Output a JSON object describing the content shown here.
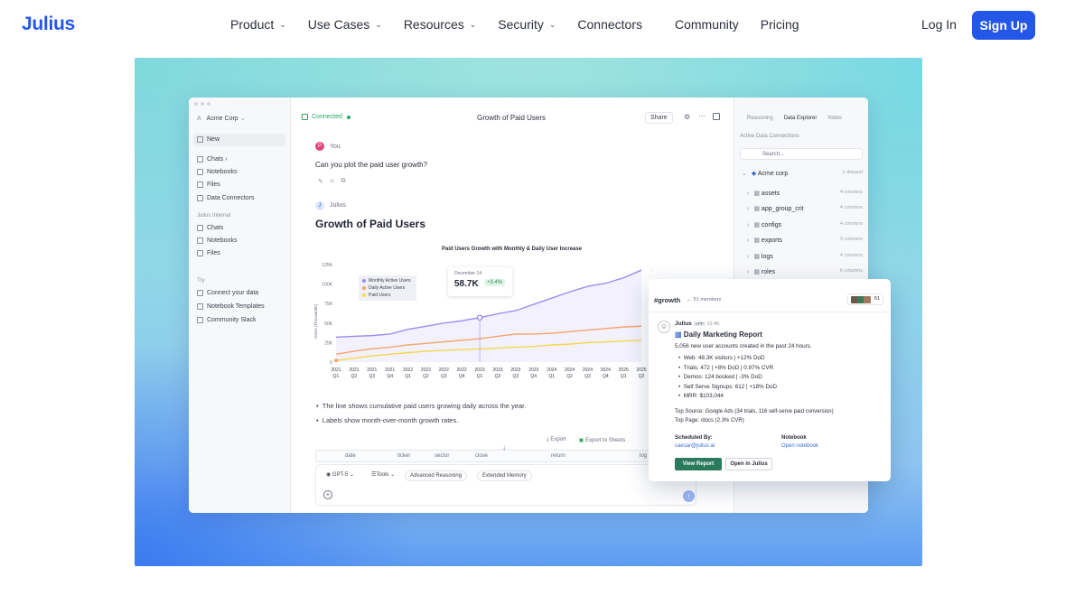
{
  "nav": {
    "logo": "Julius",
    "items": [
      {
        "label": "Product",
        "dropdown": true
      },
      {
        "label": "Use Cases",
        "dropdown": true
      },
      {
        "label": "Resources",
        "dropdown": true
      },
      {
        "label": "Security",
        "dropdown": true
      },
      {
        "label": "Connectors",
        "dropdown": false
      },
      {
        "label": "Community",
        "dropdown": false
      },
      {
        "label": "Pricing",
        "dropdown": false
      }
    ],
    "login": "Log In",
    "signup": "Sign Up"
  },
  "colors": {
    "brand": "#2457e8",
    "connected": "#27a660",
    "view_report": "#2c7a5d"
  },
  "app": {
    "sidebar": {
      "workspace": "Acme Corp",
      "new": "New",
      "items": [
        "Chats",
        "Notebooks",
        "Files",
        "Data Connectors"
      ],
      "section_internal": "Julius Internal",
      "internal_items": [
        "Chats",
        "Notebooks",
        "Files"
      ],
      "section_try": "Try",
      "try_items": [
        "Connect your data",
        "Notebook Templates",
        "Community Slack"
      ]
    },
    "topbar": {
      "connected": "Connected",
      "title": "Growth of Paid Users",
      "share": "Share"
    },
    "chat": {
      "user_initial": "P",
      "user_label": "You",
      "question": "Can you plot the paid user growth?",
      "assistant_initial": "J",
      "assistant_label": "Julius",
      "heading": "Growth of Paid Users",
      "bullets": [
        "The line shows cumulative paid users growing daily across the year.",
        "Labels show month-over-month growth rates."
      ],
      "export": "Export",
      "export_sheets": "Export to Sheets",
      "table_columns": [
        "date",
        "ticker",
        "sector",
        "close",
        "return",
        "log"
      ]
    },
    "composer": {
      "model": "GPT-5",
      "tools": "Tools",
      "chip1": "Advanced Reasoning",
      "chip2": "Extended Memory"
    },
    "right_panel": {
      "tabs": [
        "Reasoning",
        "Data Explorer",
        "Notes"
      ],
      "section": "Active Data Connections",
      "search_placeholder": "Search...",
      "source": {
        "name": "Acme corp",
        "count": "1 dataset"
      },
      "tables": [
        {
          "name": "assets",
          "cols": "4 columns"
        },
        {
          "name": "app_group_crit",
          "cols": "4 columns"
        },
        {
          "name": "configs",
          "cols": "4 columns"
        },
        {
          "name": "exports",
          "cols": "3 columns"
        },
        {
          "name": "logs",
          "cols": "4 columns"
        },
        {
          "name": "roles",
          "cols": "6 columns"
        }
      ]
    }
  },
  "chart_data": {
    "type": "line",
    "title": "Paid Users Growth with Monthly & Daily User Increase",
    "ylabel": "Users (Thousands)",
    "yticks": [
      "0",
      "25K",
      "50K",
      "75K",
      "100K",
      "125K"
    ],
    "ylim": [
      0,
      125
    ],
    "categories": [
      "2021 Q1",
      "2021 Q2",
      "2021 Q3",
      "2021 Q4",
      "2022 Q1",
      "2022 Q2",
      "2022 Q3",
      "2022 Q4",
      "2023 Q1",
      "2023 Q2",
      "2023 Q3",
      "2023 Q4",
      "2024 Q1",
      "2024 Q2",
      "2024 Q3",
      "2024 Q4",
      "2025 Q1",
      "2025 Q2"
    ],
    "series": [
      {
        "name": "Monthly Active Users",
        "color": "#9d8ef0",
        "values": [
          32,
          33,
          34,
          36,
          42,
          46,
          50,
          53,
          57,
          62,
          66,
          74,
          82,
          90,
          97,
          101,
          108,
          118
        ]
      },
      {
        "name": "Daily Active Users",
        "color": "#f4a56a",
        "values": [
          10,
          14,
          17,
          19,
          22,
          24,
          26,
          28,
          30,
          33,
          36,
          36,
          37,
          39,
          41,
          43,
          45,
          46
        ]
      },
      {
        "name": "Paid Users",
        "color": "#f5d84a",
        "values": [
          2,
          5,
          8,
          10,
          12,
          14,
          15,
          16,
          17,
          18,
          19,
          20,
          22,
          23,
          25,
          26,
          27,
          28
        ]
      }
    ],
    "tooltip": {
      "date": "December 14",
      "value": "58.7K",
      "change": "+3.4%"
    },
    "end_label": "118K"
  },
  "slack": {
    "channel": "#growth",
    "members": "51 members",
    "member_count": "51",
    "sender": "Julius",
    "app_tag": "APP",
    "time": "12:45",
    "title": "Daily Marketing Report",
    "summary": "5,056 new user accounts created in the past 24 hours.",
    "bullets": [
      "Web: 48.3K visitors | +12% DoD",
      "Trials: 472 | +8% DoD | 0.97% CVR",
      "Demos: 124 booked | -3% DoD",
      "Self Serve Signups: 612 | +18% DoD",
      "MRR: $103,044"
    ],
    "top_source": "Top Source: Google Ads (34 trials, 116 self-serve paid conversion)",
    "top_page": "Top Page: /docs (2.3% CVR)",
    "scheduled_label": "Scheduled By:",
    "scheduled_value": "caesar@julius.ai",
    "notebook_label": "Notebook",
    "notebook_value": "Open notebook",
    "view_button": "View Report",
    "open_button": "Open in Julius"
  }
}
